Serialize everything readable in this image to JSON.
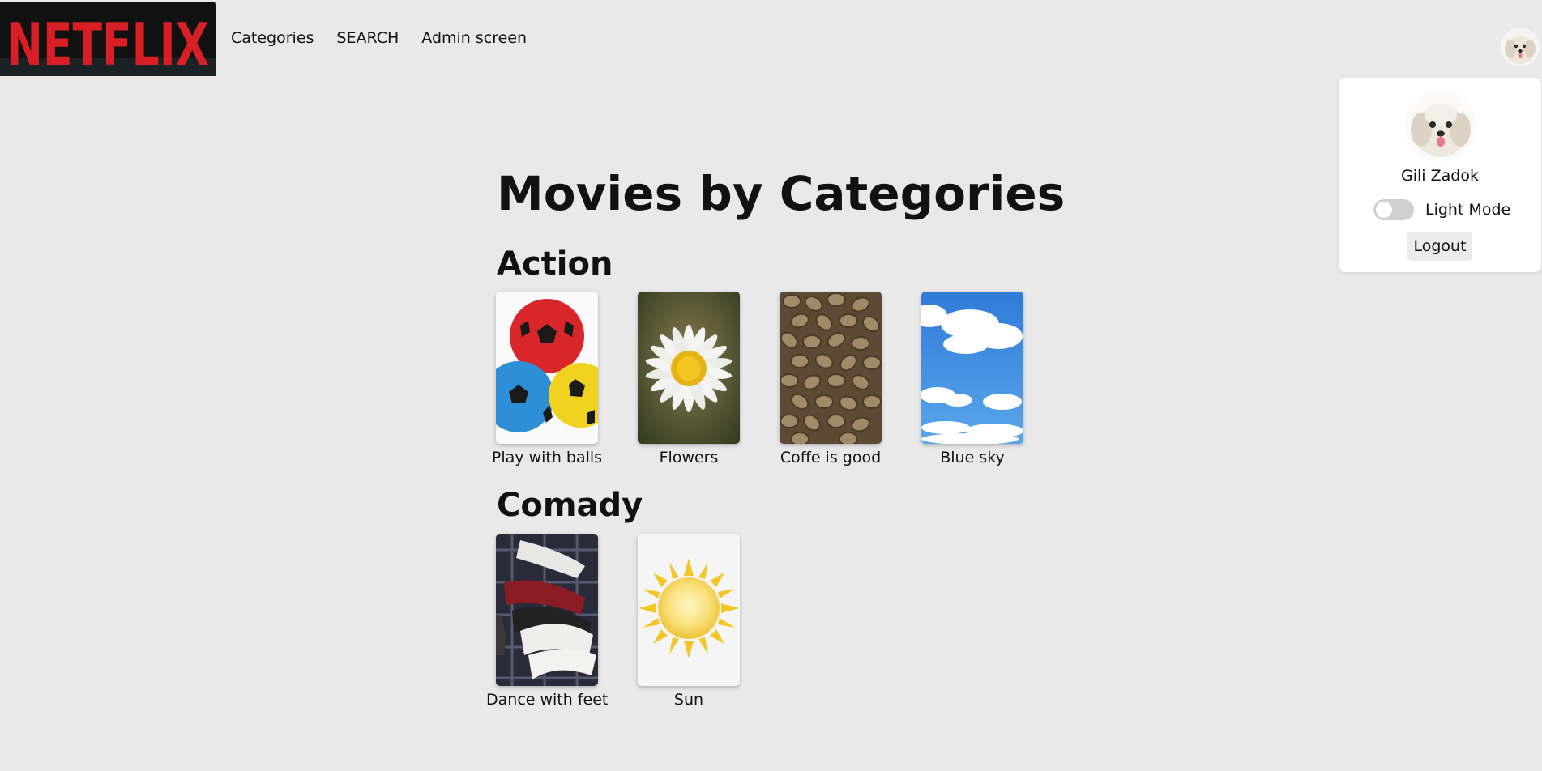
{
  "header": {
    "logo_text": "NETFLIX",
    "nav": [
      "Categories",
      "SEARCH",
      "Admin screen"
    ]
  },
  "profile": {
    "name": "Gili Zadok",
    "mode_label": "Light Mode",
    "dark_mode_on": false,
    "logout_label": "Logout"
  },
  "page": {
    "title": "Movies by Categories"
  },
  "categories": [
    {
      "name": "Action",
      "movies": [
        {
          "title": "Play with balls",
          "image": "soccer-balls-image"
        },
        {
          "title": "Flowers",
          "image": "daisy-image"
        },
        {
          "title": "Coffe is good",
          "image": "coffee-beans-image"
        },
        {
          "title": "Blue sky",
          "image": "clouds-sky-image"
        }
      ]
    },
    {
      "name": "Comady",
      "movies": [
        {
          "title": "Dance with feet",
          "image": "sneakers-image"
        },
        {
          "title": "Sun",
          "image": "sun-image"
        }
      ]
    }
  ],
  "colors": {
    "brand_red": "#e50914",
    "background": "#e9e9e9"
  }
}
